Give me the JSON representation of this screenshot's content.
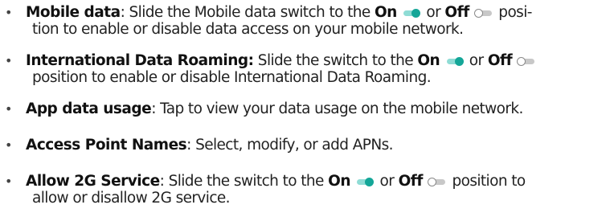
{
  "items": [
    {
      "term": "Mobile data",
      "sep": ": ",
      "a": "Slide the Mobile data switch to the ",
      "on": "On",
      "or": " or ",
      "off": "Off",
      "tail1": " posi-",
      "line2": "tion to enable or disable data access on your mobile network."
    },
    {
      "term": "International Data Roaming:",
      "a": " Slide the switch to the ",
      "on": "On",
      "or": " or ",
      "off": "Off",
      "line2": "position to enable or disable International Data Roaming."
    },
    {
      "term": "App data usage",
      "sep": ": ",
      "a": "Tap to view your data usage on the mobile network."
    },
    {
      "term": "Access Point Names",
      "sep": ": ",
      "a": "Select, modify, or add APNs."
    },
    {
      "term": "Allow 2G Service",
      "sep": ": ",
      "a": "Slide the switch to the ",
      "on": "On",
      "or": " or ",
      "off": "Off",
      "tail1": " position to",
      "line2": "allow or disallow 2G service."
    }
  ],
  "bullet": "•",
  "colors": {
    "switch_on_knob": "#14a698",
    "switch_on_track": "#8fdcd5",
    "switch_off_knob_border": "#8a8a8a",
    "switch_off_track": "#c8c8c8"
  },
  "icons": {
    "on_state": "toggle-on-icon",
    "off_state": "toggle-off-icon"
  }
}
